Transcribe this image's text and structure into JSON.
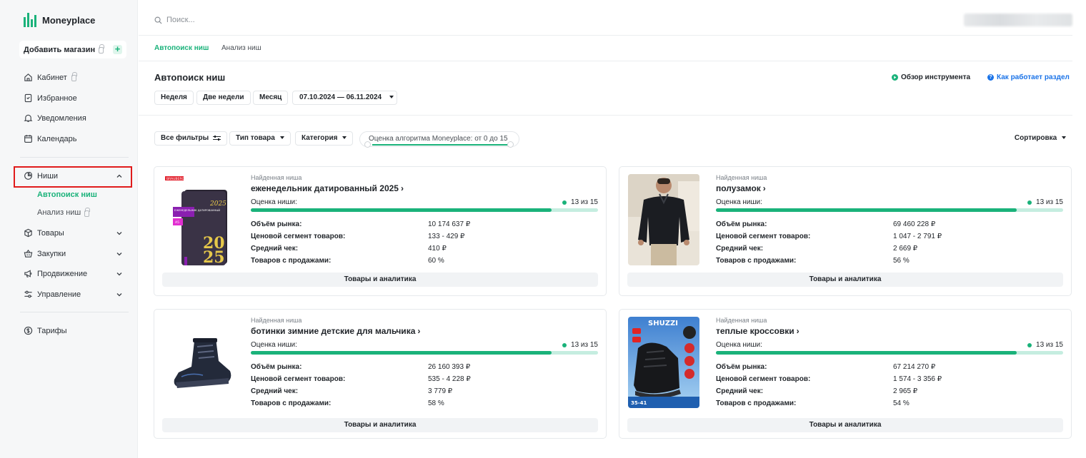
{
  "app": {
    "name": "Moneyplace"
  },
  "sidebar": {
    "add_shop": "Добавить магазин",
    "items": [
      {
        "label": "Кабинет",
        "icon": "home-icon",
        "locked": true
      },
      {
        "label": "Избранное",
        "icon": "bookmark-icon"
      },
      {
        "label": "Уведомления",
        "icon": "bell-icon"
      },
      {
        "label": "Календарь",
        "icon": "calendar-icon"
      },
      {
        "label": "Ниши",
        "icon": "pie-chart-icon",
        "expanded": true
      },
      {
        "label": "Товары",
        "icon": "box-icon"
      },
      {
        "label": "Закупки",
        "icon": "basket-icon"
      },
      {
        "label": "Продвижение",
        "icon": "megaphone-icon"
      },
      {
        "label": "Управление",
        "icon": "sliders-icon"
      },
      {
        "label": "Тарифы",
        "icon": "dollar-circle-icon"
      }
    ],
    "niche_sub": [
      {
        "label": "Автопоиск ниш",
        "active": true
      },
      {
        "label": "Анализ ниш",
        "locked": true
      }
    ]
  },
  "header": {
    "search_placeholder": "Поиск..."
  },
  "tabs": [
    {
      "label": "Автопоиск ниш",
      "active": true
    },
    {
      "label": "Анализ ниш",
      "active": false
    }
  ],
  "page": {
    "title": "Автопоиск ниш",
    "overview_link": "Обзор инструмента",
    "help_link": "Как работает раздел",
    "periods": [
      "Неделя",
      "Две недели",
      "Месяц"
    ],
    "date_range": "07.10.2024 — 06.11.2024"
  },
  "filters": {
    "all": "Все фильтры",
    "type": "Тип товара",
    "category": "Категория",
    "score_prefix": "Оценка алгоритма Moneyplace: от",
    "score_from": "0",
    "score_mid": "до",
    "score_to": "15",
    "sort": "Сортировка"
  },
  "card_labels": {
    "kicker": "Найденная ниша",
    "score": "Оценка ниши:",
    "volume": "Объём рынка:",
    "segment": "Ценовой сегмент товаров:",
    "avg_check": "Средний чек:",
    "with_sales": "Товаров с продажами:",
    "action": "Товары и аналитика"
  },
  "cards": [
    {
      "title": "еженедельник датированный 2025",
      "score_text": "13 из 15",
      "score_fraction": 0.867,
      "volume": "10 174 637 ₽",
      "segment": "133 - 429 ₽",
      "avg_check": "410 ₽",
      "with_sales": "60 %",
      "image": "planner-image",
      "image_text": {
        "brand": "BRAUBERG",
        "year": "2025",
        "cover_label": "ЕЖЕНЕДЕЛЬНИК ДАТИРОВАННЫЙ",
        "size": "А5"
      }
    },
    {
      "title": "полузамок",
      "score_text": "13 из 15",
      "score_fraction": 0.867,
      "volume": "69 460 228 ₽",
      "segment": "1 047 - 2 791 ₽",
      "avg_check": "2 669 ₽",
      "with_sales": "56 %",
      "image": "sweater-image"
    },
    {
      "title": "ботинки зимние детские для мальчика",
      "score_text": "13 из 15",
      "score_fraction": 0.867,
      "volume": "26 160 393 ₽",
      "segment": "535 - 4 228 ₽",
      "avg_check": "3 779 ₽",
      "with_sales": "58 %",
      "image": "boot-image"
    },
    {
      "title": "теплые кроссовки",
      "score_text": "13 из 15",
      "score_fraction": 0.867,
      "volume": "67 214 270 ₽",
      "segment": "1 574 - 3 356 ₽",
      "avg_check": "2 965 ₽",
      "with_sales": "54 %",
      "image": "sneaker-image",
      "image_text": {
        "brand": "SHUZZI",
        "sizes": "35-41"
      }
    }
  ],
  "colors": {
    "accent": "#1ab27a",
    "highlight": "#e01b1b",
    "help_blue": "#1a73e8"
  }
}
